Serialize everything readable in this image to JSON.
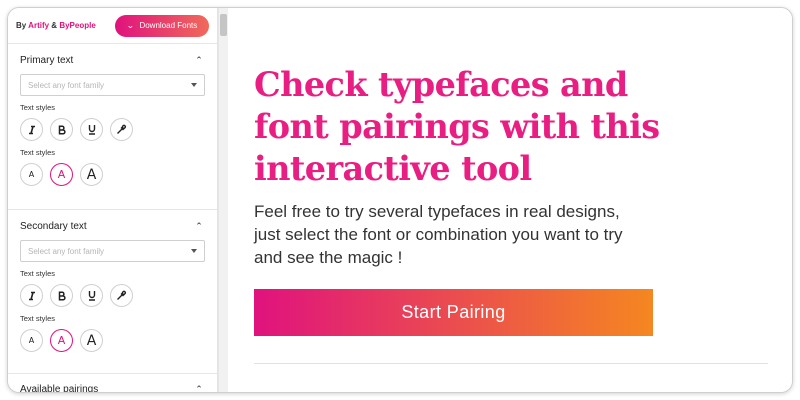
{
  "sidebar": {
    "brand": {
      "by": "By",
      "artify": "Artify",
      "amp": "&",
      "bypeople": "ByPeople"
    },
    "download_button": "Download Fonts",
    "primary": {
      "title": "Primary text",
      "select_placeholder": "Select any font family",
      "text_styles_label": "Text styles",
      "size_label": "Text styles",
      "style_buttons": [
        "italic-icon",
        "bold-icon",
        "underline-icon",
        "eyedropper-icon"
      ],
      "size_buttons": [
        "A",
        "A",
        "A"
      ],
      "active_size_index": 1
    },
    "secondary": {
      "title": "Secondary text",
      "select_placeholder": "Select any font family",
      "text_styles_label": "Text styles",
      "size_label": "Text styles",
      "size_buttons": [
        "A",
        "A",
        "A"
      ],
      "active_size_index": 1
    },
    "pairings": {
      "title": "Available pairings"
    }
  },
  "main": {
    "headline": "Check typefaces and font pairings with this interactive tool",
    "subtext": "Feel free to try several typefaces in real designs, just select the font or combination you want to try and see the magic !",
    "start_button": "Start Pairing"
  },
  "colors": {
    "accent": "#e0127e",
    "gradient_end": "#f58720",
    "headline": "#e91e82"
  }
}
